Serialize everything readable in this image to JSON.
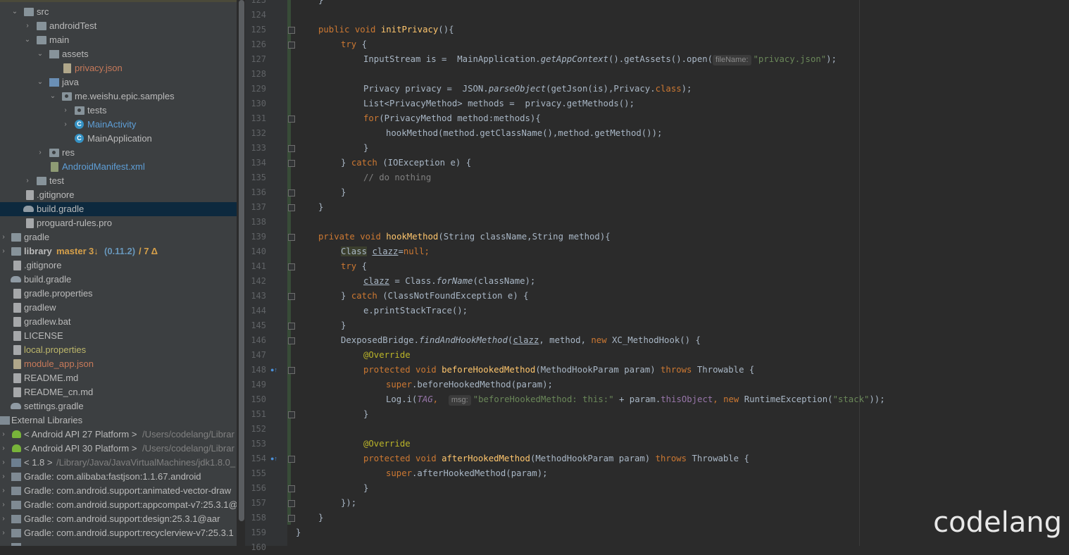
{
  "project_tree": [
    {
      "label": "src"
    },
    {
      "label": "androidTest"
    },
    {
      "label": "main"
    },
    {
      "label": "assets"
    },
    {
      "label": "privacy.json"
    },
    {
      "label": "java"
    },
    {
      "label": "me.weishu.epic.samples"
    },
    {
      "label": "tests"
    },
    {
      "label": "MainActivity"
    },
    {
      "label": "MainApplication"
    },
    {
      "label": "res"
    },
    {
      "label": "AndroidManifest.xml"
    },
    {
      "label": "test"
    },
    {
      "label": ".gitignore"
    },
    {
      "label": "build.gradle"
    },
    {
      "label": "proguard-rules.pro"
    },
    {
      "label": "gradle"
    },
    {
      "label": "library",
      "branch": "master",
      "ahead": "3↓",
      "version": "(0.11.2)",
      "changes": "/ 7 Δ"
    },
    {
      "label": ".gitignore"
    },
    {
      "label": "build.gradle"
    },
    {
      "label": "gradle.properties"
    },
    {
      "label": "gradlew"
    },
    {
      "label": "gradlew.bat"
    },
    {
      "label": "LICENSE"
    },
    {
      "label": "local.properties"
    },
    {
      "label": "module_app.json"
    },
    {
      "label": "README.md"
    },
    {
      "label": "README_cn.md"
    },
    {
      "label": "settings.gradle"
    },
    {
      "label": "External Libraries"
    },
    {
      "label": "< Android API 27 Platform >",
      "path": "/Users/codelang/Librar"
    },
    {
      "label": "< Android API 30 Platform >",
      "path": "/Users/codelang/Librar"
    },
    {
      "label": "< 1.8 >",
      "path": "/Library/Java/JavaVirtualMachines/jdk1.8.0_"
    },
    {
      "label": "Gradle: com.alibaba:fastjson:1.1.67.android"
    },
    {
      "label": "Gradle: com.android.support:animated-vector-draw"
    },
    {
      "label": "Gradle: com.android.support:appcompat-v7:25.3.1@"
    },
    {
      "label": "Gradle: com.android.support:design:25.3.1@aar"
    },
    {
      "label": "Gradle: com.android.support:recyclerview-v7:25.3.1"
    }
  ],
  "line_numbers": [
    "123",
    "124",
    "125",
    "126",
    "127",
    "128",
    "129",
    "130",
    "131",
    "132",
    "133",
    "134",
    "135",
    "136",
    "137",
    "138",
    "139",
    "140",
    "141",
    "142",
    "143",
    "144",
    "145",
    "146",
    "147",
    "148",
    "149",
    "150",
    "151",
    "152",
    "153",
    "154",
    "155",
    "156",
    "157",
    "158",
    "159",
    "160"
  ],
  "code": {
    "l123": "}",
    "kw_public": "public",
    "kw_void": "void",
    "fn_initPrivacy": "initPrivacy",
    "l125_end": "(){",
    "kw_try": "try",
    "brace_open": " {",
    "l127_a": "InputStream is =  MainApplication.",
    "l127_getAppContext": "getAppContext",
    "l127_b": "().getAssets().open(",
    "hint_fileName": "fileName:",
    "str_privacy_json": "\"privacy.json\"",
    "l127_end": ");",
    "l129_a": "Privacy privacy =  JSON.",
    "l129_parseObject": "parseObject",
    "l129_b": "(getJson(is),Privacy.",
    "kw_class": "class",
    "l129_end": ");",
    "l130": "List<PrivacyMethod> methods =  privacy.getMethods();",
    "kw_for": "for",
    "l131_b": "(PrivacyMethod method:methods){",
    "l132": "hookMethod(method.getClassName(),method.getMethod());",
    "brace_close": "}",
    "l134_a": "} ",
    "kw_catch": "catch",
    "l134_b": " (IOException e) {",
    "l135_comment": "// do nothing",
    "kw_private": "private",
    "fn_hookMethod": "hookMethod",
    "l139_b": "(String className,String method){",
    "l140_Class": "Class",
    "l140_clazz": "clazz",
    "l140_eq": "=",
    "kw_null": "null",
    "semi": ";",
    "l142_b": " = Class.",
    "l142_forName": "forName",
    "l142_c": "(className);",
    "l143_b": " (ClassNotFoundException e) {",
    "l144": "e.printStackTrace();",
    "l146_a": "DexposedBridge.",
    "l146_find": "findAndHookMethod",
    "l146_b": "(",
    "l146_c": ", method, ",
    "kw_new": "new",
    "l146_d": " XC_MethodHook() {",
    "ann_override": "@Override",
    "kw_protected": "protected",
    "fn_beforeHooked": "beforeHookedMethod",
    "l148_b": "(MethodHookParam param) ",
    "kw_throws": "throws",
    "l148_c": " Throwable {",
    "kw_super": "super",
    "l149_b": ".beforeHookedMethod(param);",
    "l150_a": "Log.i(",
    "cst_TAG": "TAG",
    "comma": ", ",
    "hint_msg": "msg:",
    "str_before": "\"beforeHookedMethod: this:\"",
    "l150_b": " + param.",
    "fld_thisObject": "thisObject",
    "l150_c": " RuntimeException(",
    "str_stack": "\"stack\"",
    "l150_end": "));",
    "fn_afterHooked": "afterHookedMethod",
    "l155_b": ".afterHookedMethod(param);",
    "l157": "});",
    "l159": "}"
  },
  "watermark": "codelang"
}
